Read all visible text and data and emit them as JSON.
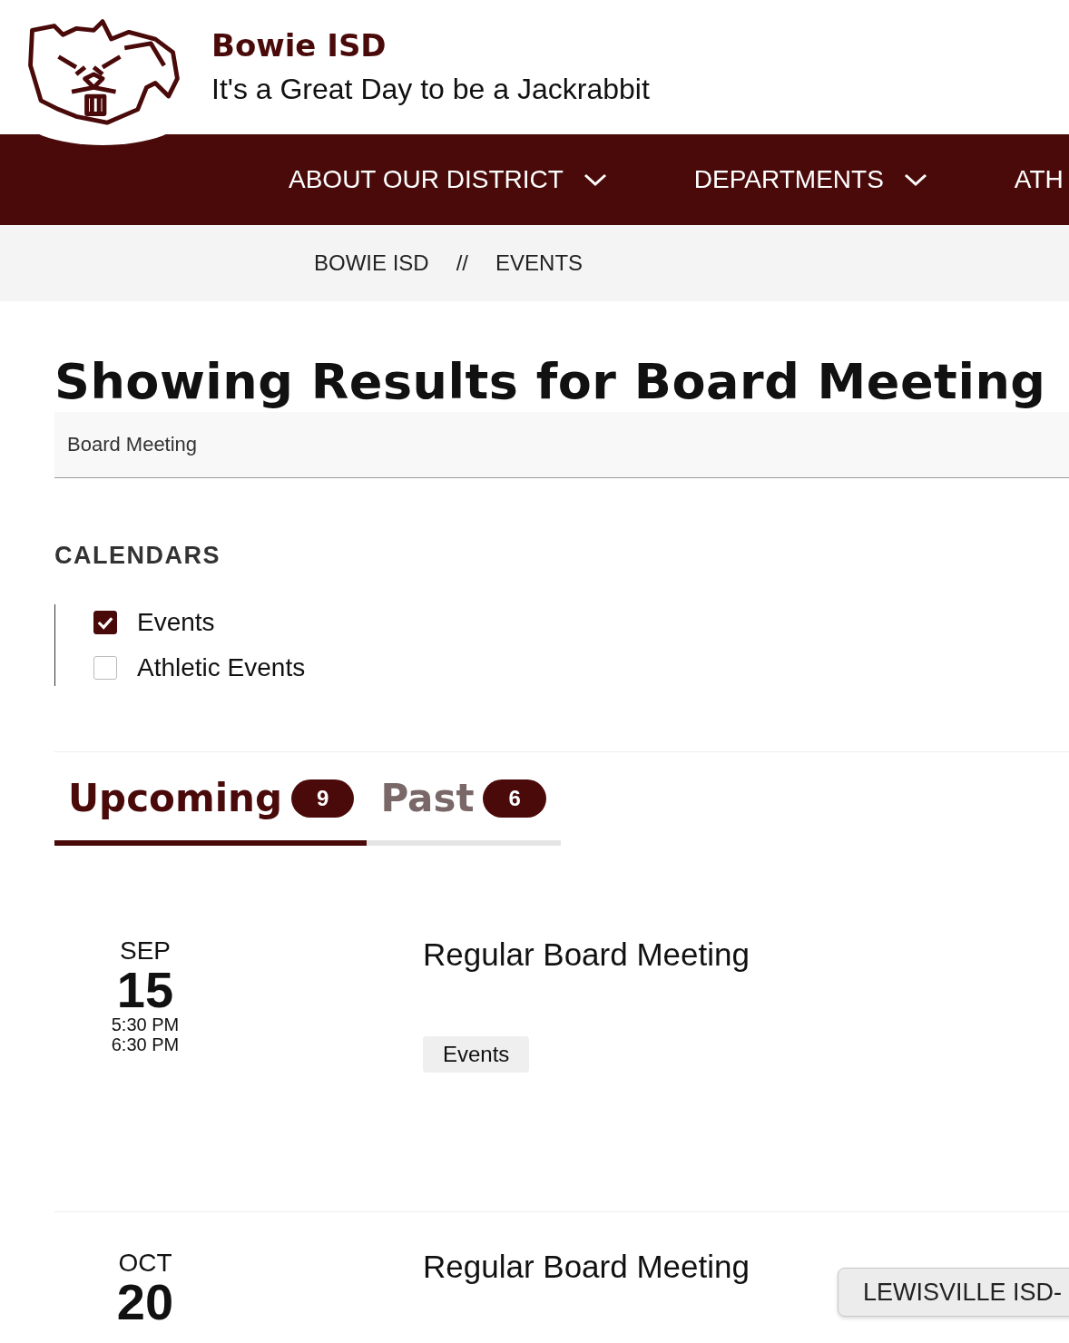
{
  "site": {
    "name": "Bowie ISD",
    "tagline": "It's a Great Day to be a Jackrabbit"
  },
  "nav": [
    {
      "label": "ABOUT OUR DISTRICT",
      "has_menu": true
    },
    {
      "label": "DEPARTMENTS",
      "has_menu": true
    },
    {
      "label": "ATH",
      "has_menu": false
    }
  ],
  "breadcrumb": [
    "BOWIE ISD",
    "EVENTS"
  ],
  "breadcrumb_separator": "//",
  "heading": "Showing Results for Board Meeting",
  "search": {
    "value": "Board Meeting"
  },
  "calendars": {
    "title": "CALENDARS",
    "items": [
      {
        "label": "Events",
        "checked": true
      },
      {
        "label": "Athletic Events",
        "checked": false
      }
    ]
  },
  "tabs": [
    {
      "label": "Upcoming",
      "count": "9",
      "selected": true
    },
    {
      "label": "Past",
      "count": "6",
      "selected": false
    }
  ],
  "events": [
    {
      "month": "SEP",
      "day": "15",
      "times": [
        "5:30 PM",
        "6:30 PM"
      ],
      "title": "Regular Board Meeting",
      "tags": [
        "Events"
      ]
    },
    {
      "month": "OCT",
      "day": "20",
      "title": "Regular Board Meeting"
    }
  ],
  "floating_button": "LEWISVILLE ISD-"
}
